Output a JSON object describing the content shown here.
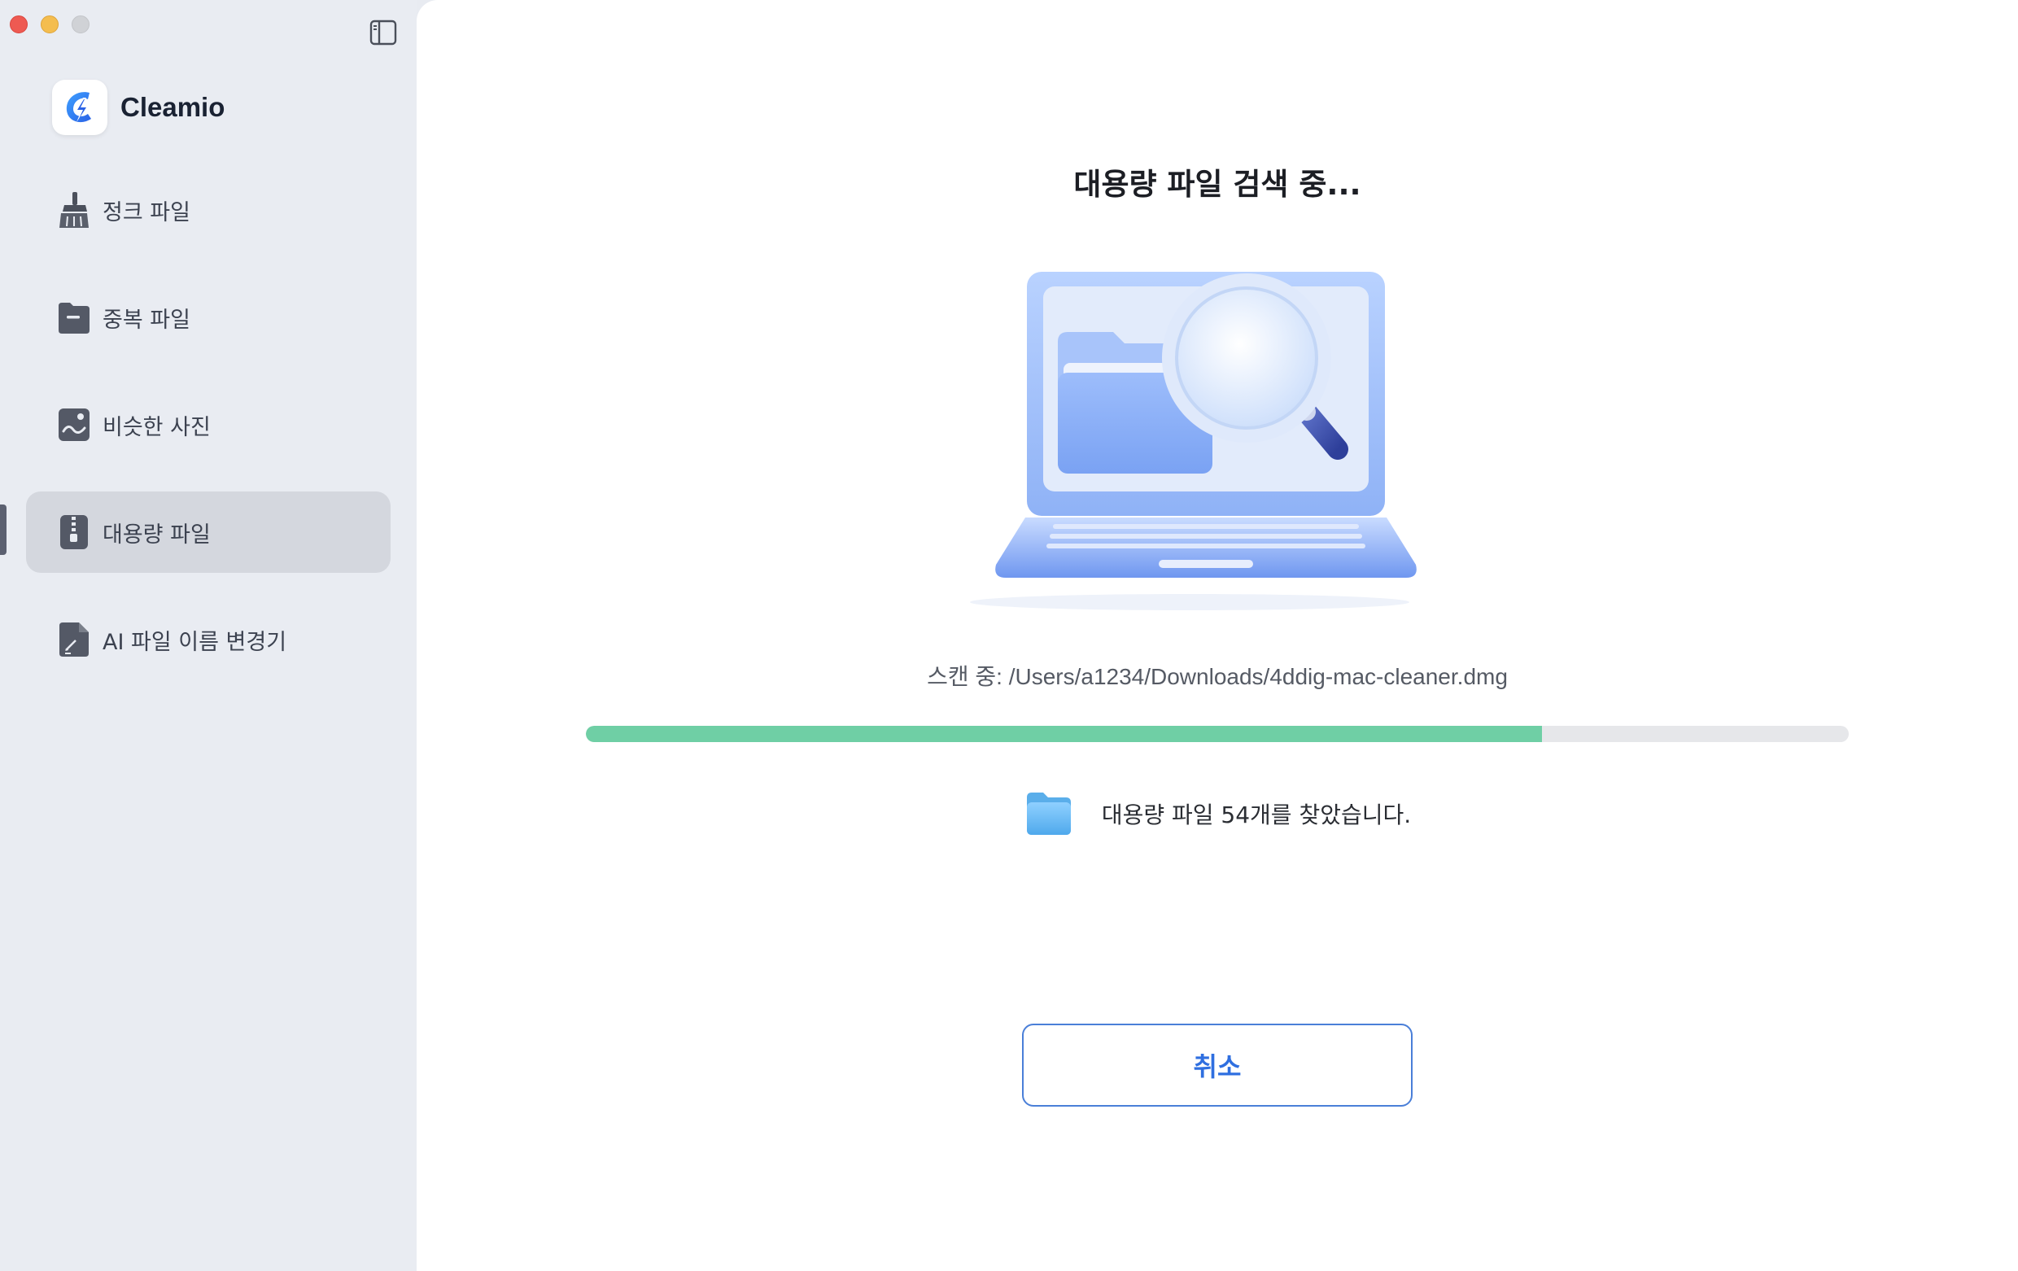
{
  "sidebar": {
    "brand": {
      "name": "Cleamio",
      "logo_icon": "cleamio-logo-icon"
    },
    "items": [
      {
        "label": "정크 파일",
        "icon": "broom-icon",
        "active": false
      },
      {
        "label": "중복 파일",
        "icon": "folder-minus-icon",
        "active": false
      },
      {
        "label": "비슷한 사진",
        "icon": "photo-icon",
        "active": false
      },
      {
        "label": "대용량 파일",
        "icon": "zip-file-icon",
        "active": true
      },
      {
        "label": "AI 파일 이름 변경기",
        "icon": "file-rename-icon",
        "active": false
      }
    ]
  },
  "main": {
    "title": "대용량 파일 검색 중...",
    "scan_status": "스캔 중: /Users/a1234/Downloads/4ddig-mac-cleaner.dmg",
    "progress": 0.757,
    "found_text": "대용량 파일 54개를 찾았습니다.",
    "cancel_label": "취소"
  },
  "colors": {
    "accent": "#2f6fe0",
    "progress_fill": "#6fcfa5",
    "progress_track": "#e6e7ea",
    "sidebar_bg": "#e9ecf2",
    "active_item_bg": "#d4d7de"
  }
}
